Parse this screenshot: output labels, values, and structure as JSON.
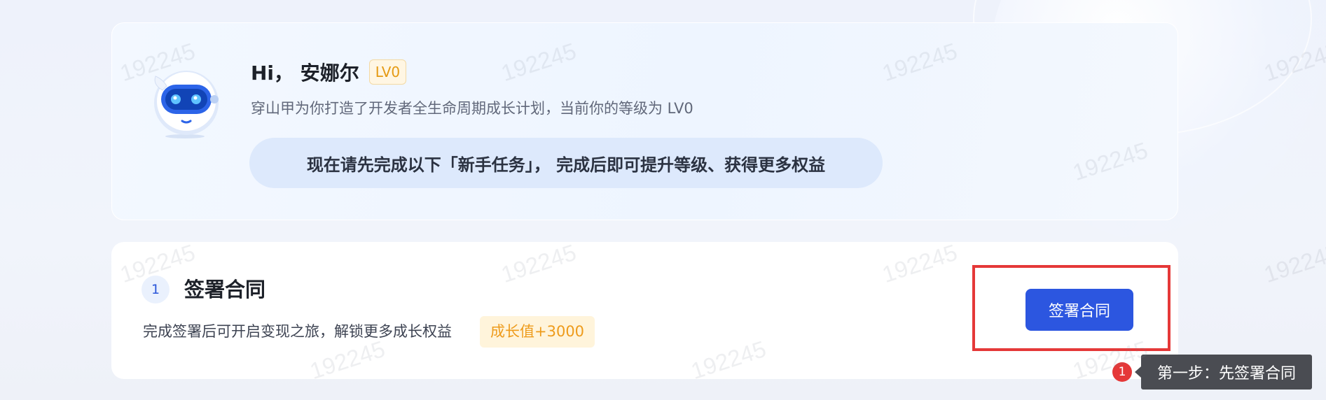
{
  "header": {
    "greeting": "Hi， 安娜尔",
    "level_badge": "LV0",
    "subtitle": "穿山甲为你打造了开发者全生命周期成长计划，当前你的等级为 LV0",
    "notice": "现在请先完成以下「新手任务」， 完成后即可提升等级、获得更多权益",
    "mascot_icon": "robot-mascot"
  },
  "task": {
    "step_number": "1",
    "title": "签署合同",
    "description": "完成签署后可开启变现之旅，解锁更多成长权益",
    "growth_badge": "成长值+3000",
    "button_label": "签署合同"
  },
  "guide": {
    "marker": "1",
    "tooltip": "第一步：先签署合同"
  },
  "watermark": "192245",
  "colors": {
    "primary_button": "#2c56e0",
    "highlight_border": "#e53838",
    "growth_badge_text": "#ee9b1b",
    "level_badge_text": "#e59a13"
  }
}
